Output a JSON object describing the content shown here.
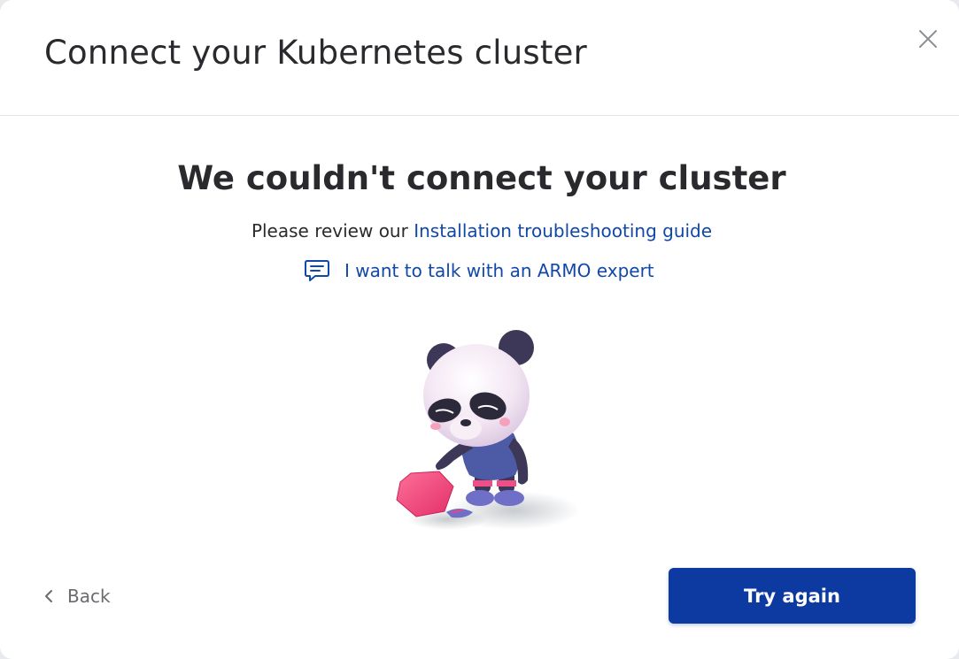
{
  "dialog": {
    "title": "Connect your Kubernetes cluster",
    "close_icon": "close-icon"
  },
  "status": {
    "heading": "We couldn't connect your cluster",
    "review_prefix": "Please review our ",
    "troubleshooting_link": "Installation troubleshooting guide",
    "expert_link": "I want to talk with an ARMO expert",
    "expert_icon": "chat-bubble-icon"
  },
  "illustration": {
    "name": "panda-mascot-illustration"
  },
  "footer": {
    "back_label": "Back",
    "back_icon": "chevron-left-icon",
    "primary_label": "Try again"
  },
  "colors": {
    "primary": "#0d3aa0",
    "link": "#1148a8",
    "accent_pink": "#f0457a"
  }
}
